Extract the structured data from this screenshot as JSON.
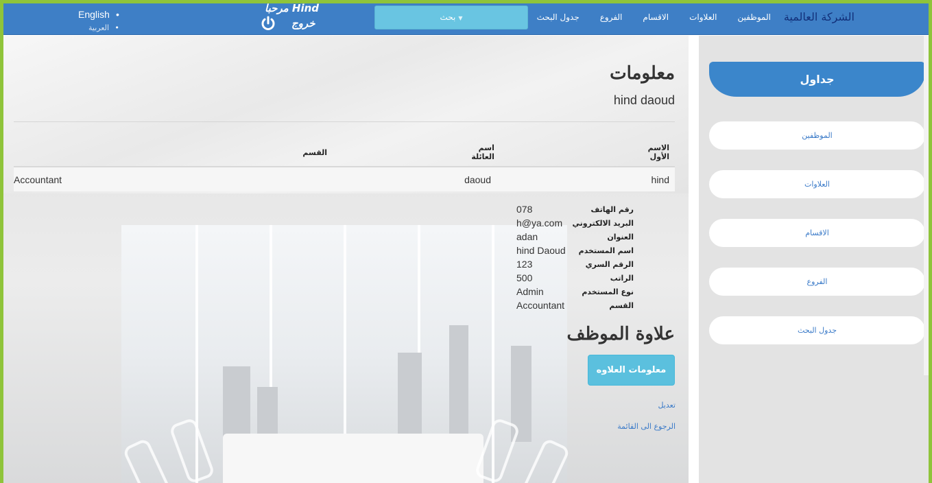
{
  "navbar": {
    "brand": "الشركة العالمية",
    "links": [
      "الموظفين",
      "العلاوات",
      "الاقسام",
      "الفروع",
      "جدول البحث"
    ],
    "search_label": "بحث",
    "welcome": "مرحبا Hind",
    "logout": "خروج",
    "languages": [
      "English",
      "العربية"
    ]
  },
  "main": {
    "info_title": "معلومات",
    "full_name": "hind daoud",
    "table": {
      "headers": [
        "الاسم الأول",
        "اسم العائلة",
        "القسم"
      ],
      "row": [
        "hind",
        "daoud",
        "Accountant"
      ]
    },
    "details": [
      {
        "label": "رقم الهاتف",
        "value": "078"
      },
      {
        "label": "البريد الالكتروني",
        "value": "h@ya.com"
      },
      {
        "label": "العنوان",
        "value": "adan"
      },
      {
        "label": "اسم المستخدم",
        "value": "hind Daoud"
      },
      {
        "label": "الرقم السري",
        "value": "123"
      },
      {
        "label": "الراتب",
        "value": "500"
      },
      {
        "label": "نوع المستخدم",
        "value": "Admin"
      },
      {
        "label": "القسم",
        "value": "Accountant"
      }
    ],
    "allowance_title": "علاوة الموظف",
    "allowance_button": "معلومات العلاوه",
    "edit_link": "تعديل",
    "back_link": "الرجوع الى القائمة"
  },
  "sidebar": {
    "title": "جداول",
    "items": [
      "الموظفين",
      "العلاوات",
      "الاقسام",
      "الفروع",
      "جدول البحث"
    ]
  },
  "colors": {
    "navbar": "#3e7fc6",
    "accent": "#5bc0de",
    "border": "#8fc43a"
  }
}
